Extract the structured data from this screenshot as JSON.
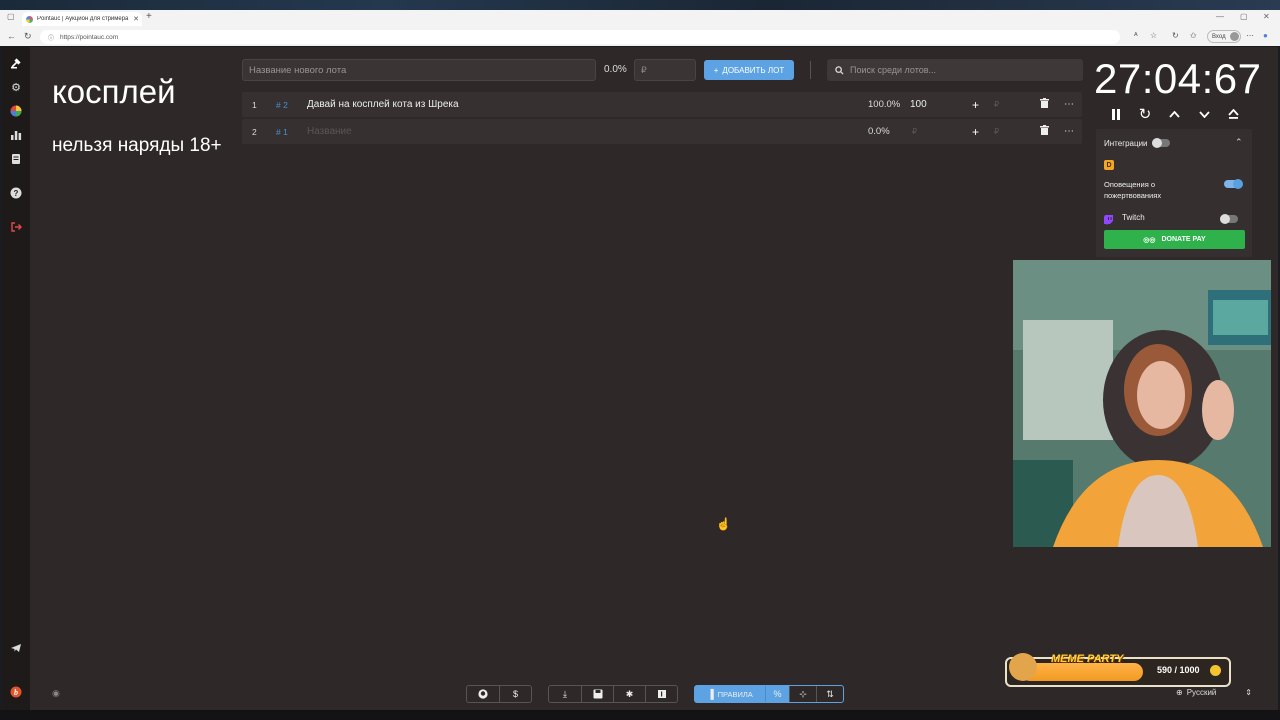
{
  "browser": {
    "tab_title": "Pointauc | Аукцион для стримера",
    "url": "https://pointauc.com",
    "signin_label": "Вход"
  },
  "sidebar": {
    "items": [
      {
        "name": "auction-icon"
      },
      {
        "name": "gear-icon"
      },
      {
        "name": "wheel-icon"
      },
      {
        "name": "stats-icon"
      },
      {
        "name": "history-icon"
      },
      {
        "name": "help-icon"
      },
      {
        "name": "logout-icon"
      },
      {
        "name": "telegram-icon"
      },
      {
        "name": "brand-icon"
      }
    ]
  },
  "main": {
    "title": "косплей",
    "subtitle": "нельзя наряды 18+"
  },
  "toolbar": {
    "new_lot_placeholder": "Название нового лота",
    "percent": "0.0%",
    "currency_placeholder": "₽",
    "add_lot_label": "ДОБАВИТЬ ЛОТ",
    "search_placeholder": "Поиск среди лотов..."
  },
  "lots": [
    {
      "index": "1",
      "hash_id": "# 2",
      "name": "Давай на косплей кота из Шрека",
      "percent": "100.0%",
      "amount": "100",
      "rub": "₽"
    },
    {
      "index": "2",
      "hash_id": "# 1",
      "name": "Название",
      "percent": "0.0%",
      "amount": "₽",
      "rub": "₽"
    }
  ],
  "timer": {
    "display": "27:04:67"
  },
  "integrations": {
    "header": "Интеграции",
    "header_toggle": false,
    "notify_label": "Оповещения о пожертвованиях",
    "notify_toggle": true,
    "twitch_label": "Twitch",
    "twitch_toggle": false,
    "donate_pay_label": "DONATE PAY"
  },
  "overlay": {
    "meme_party_label": "MEME PARTY",
    "score": "590 / 1000"
  },
  "footer": {
    "rules_label": "ПРАВИЛА",
    "language": "Русский"
  },
  "colors": {
    "accent": "#5da3e3",
    "donate_green": "#2fb24c",
    "background": "#2e2828"
  }
}
